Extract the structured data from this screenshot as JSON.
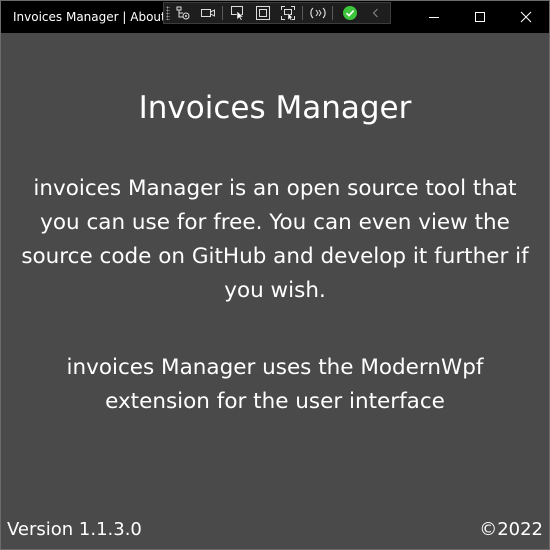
{
  "window": {
    "title": "Invoices Manager | About"
  },
  "toolbar": {
    "icons": [
      "live-visual-tree-icon",
      "display-capture-icon",
      "select-element-icon",
      "display-layout-adorners-icon",
      "track-focus-icon",
      "hot-reload-icon",
      "binding-failures-ok-icon",
      "collapse-toolbar-icon"
    ]
  },
  "caption_buttons": [
    "minimize",
    "maximize",
    "close"
  ],
  "about": {
    "heading": "Invoices Manager",
    "paragraph1": "invoices Manager is an open source tool that you can use for free. You can even view the source code on GitHub and develop it further if you wish.",
    "paragraph2": "invoices Manager uses the ModernWpf extension for the user interface",
    "version": "Version 1.1.3.0",
    "copyright": "©2022"
  },
  "colors": {
    "background": "#4a4a4a",
    "titlebar": "#000000",
    "text": "#ffffff",
    "status_ok": "#3cc43c"
  }
}
